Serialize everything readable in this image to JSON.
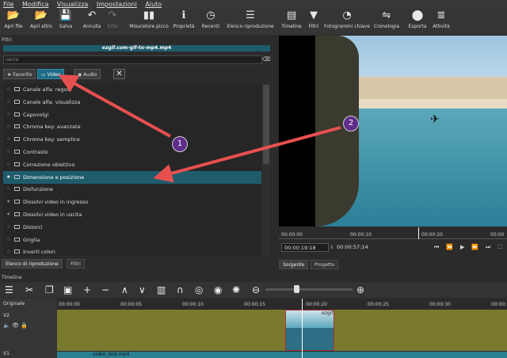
{
  "menu": [
    "File",
    "Modifica",
    "Visualizza",
    "Impostazioni",
    "Aiuto"
  ],
  "toolbar": [
    {
      "label": "Apri file",
      "icon": "folder-icon",
      "glyph": "📂"
    },
    {
      "label": "Apri altro",
      "icon": "folder-open-icon",
      "glyph": "📂"
    },
    {
      "label": "Salva",
      "icon": "save-icon",
      "glyph": "💾"
    },
    {
      "label": "Annulla",
      "icon": "undo-icon",
      "glyph": "↶"
    },
    {
      "label": "Rifai",
      "icon": "redo-icon",
      "glyph": "↷",
      "disabled": true
    },
    {
      "label": "Misuratore picco",
      "icon": "meter-icon",
      "glyph": "▮▮"
    },
    {
      "label": "Proprietà",
      "icon": "info-icon",
      "glyph": "ℹ"
    },
    {
      "label": "Recenti",
      "icon": "history-icon",
      "glyph": "◷"
    },
    {
      "label": "Elenco riproduzione",
      "icon": "list-icon",
      "glyph": "☰"
    },
    {
      "label": "Timeline",
      "icon": "timeline-icon",
      "glyph": "▤"
    },
    {
      "label": "Filtri",
      "icon": "filter-icon",
      "glyph": "▼"
    },
    {
      "label": "Fotogrammi chiave",
      "icon": "stopwatch-icon",
      "glyph": "◔"
    },
    {
      "label": "Cronologia",
      "icon": "cronologia-icon",
      "glyph": "⇋"
    },
    {
      "label": "Esporta",
      "icon": "export-icon",
      "glyph": "⬤"
    },
    {
      "label": "Attività",
      "icon": "tasks-icon",
      "glyph": "≣"
    }
  ],
  "filters": {
    "title": "Filtri",
    "clip_name": "ezgif.com-gif-to-mp4.mp4",
    "search_placeholder": "cerca",
    "tabs": [
      "Favorito",
      "Video",
      "Audio"
    ],
    "items": [
      {
        "label": "Canale alfa: regola",
        "fav": false
      },
      {
        "label": "Canale alfa: visualizza",
        "fav": false
      },
      {
        "label": "Capovolgi",
        "fav": false
      },
      {
        "label": "Chroma key: avanzate",
        "fav": false
      },
      {
        "label": "Chroma key: semplice",
        "fav": false
      },
      {
        "label": "Contrasto",
        "fav": false
      },
      {
        "label": "Correzione obiettivo",
        "fav": false
      },
      {
        "label": "Dimensione e posizione",
        "fav": true,
        "selected": true
      },
      {
        "label": "Disfunzione",
        "fav": false
      },
      {
        "label": "Dissolvi video in ingresso",
        "fav": true
      },
      {
        "label": "Dissolvi video in uscita",
        "fav": true
      },
      {
        "label": "Distorci",
        "fav": false
      },
      {
        "label": "Griglia",
        "fav": false
      },
      {
        "label": "Inverti colori",
        "fav": false
      }
    ]
  },
  "bottom_tabs": [
    "Elenco di riproduzione",
    "Filtri"
  ],
  "viewer_tabs": [
    "Sorgente",
    "Progetto"
  ],
  "viewer": {
    "ruler": [
      "00:00:00",
      "00:00:10",
      "00:00:20",
      "00:00"
    ],
    "timecode": "00:00:19:18",
    "total": "00:00:57:14"
  },
  "timeline": {
    "title": "Timeline",
    "track_header": "Originale",
    "tracks": [
      "V2",
      "V1"
    ],
    "ruler": [
      "00:00:00",
      "00:00:05",
      "00:00:10",
      "00:00:15",
      "00:00:20",
      "00:00:25",
      "00:00:30",
      "00:00:"
    ],
    "clip_label": "ezgif",
    "v1_clip_label": "video_test.mp4"
  },
  "callouts": [
    "1",
    "2"
  ]
}
